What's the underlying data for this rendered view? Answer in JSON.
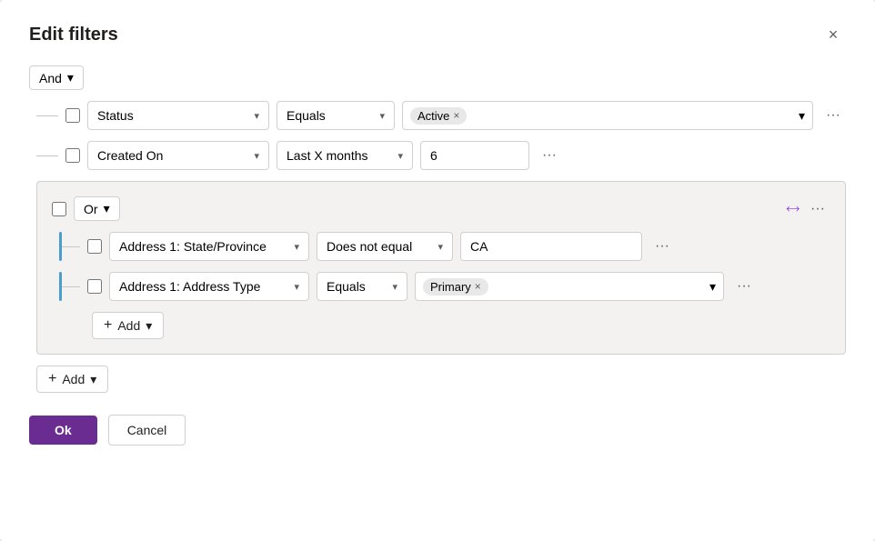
{
  "dialog": {
    "title": "Edit filters",
    "close_label": "×"
  },
  "and_dropdown": {
    "label": "And",
    "chevron": "▾"
  },
  "rows": [
    {
      "field": "Status",
      "operator": "Equals",
      "value_tag": "Active",
      "value_type": "tag"
    },
    {
      "field": "Created On",
      "operator": "Last X months",
      "value": "6",
      "value_type": "input"
    }
  ],
  "or_group": {
    "label": "Or",
    "chevron": "▾",
    "collapse_icon": "⤢",
    "rows": [
      {
        "field": "Address 1: State/Province",
        "operator": "Does not equal",
        "value": "CA",
        "value_type": "text"
      },
      {
        "field": "Address 1: Address Type",
        "operator": "Equals",
        "value_tag": "Primary",
        "value_type": "tag"
      }
    ],
    "add_label": "Add",
    "add_chevron": "▾"
  },
  "add_button": {
    "label": "Add",
    "chevron": "▾"
  },
  "footer": {
    "ok_label": "Ok",
    "cancel_label": "Cancel"
  }
}
